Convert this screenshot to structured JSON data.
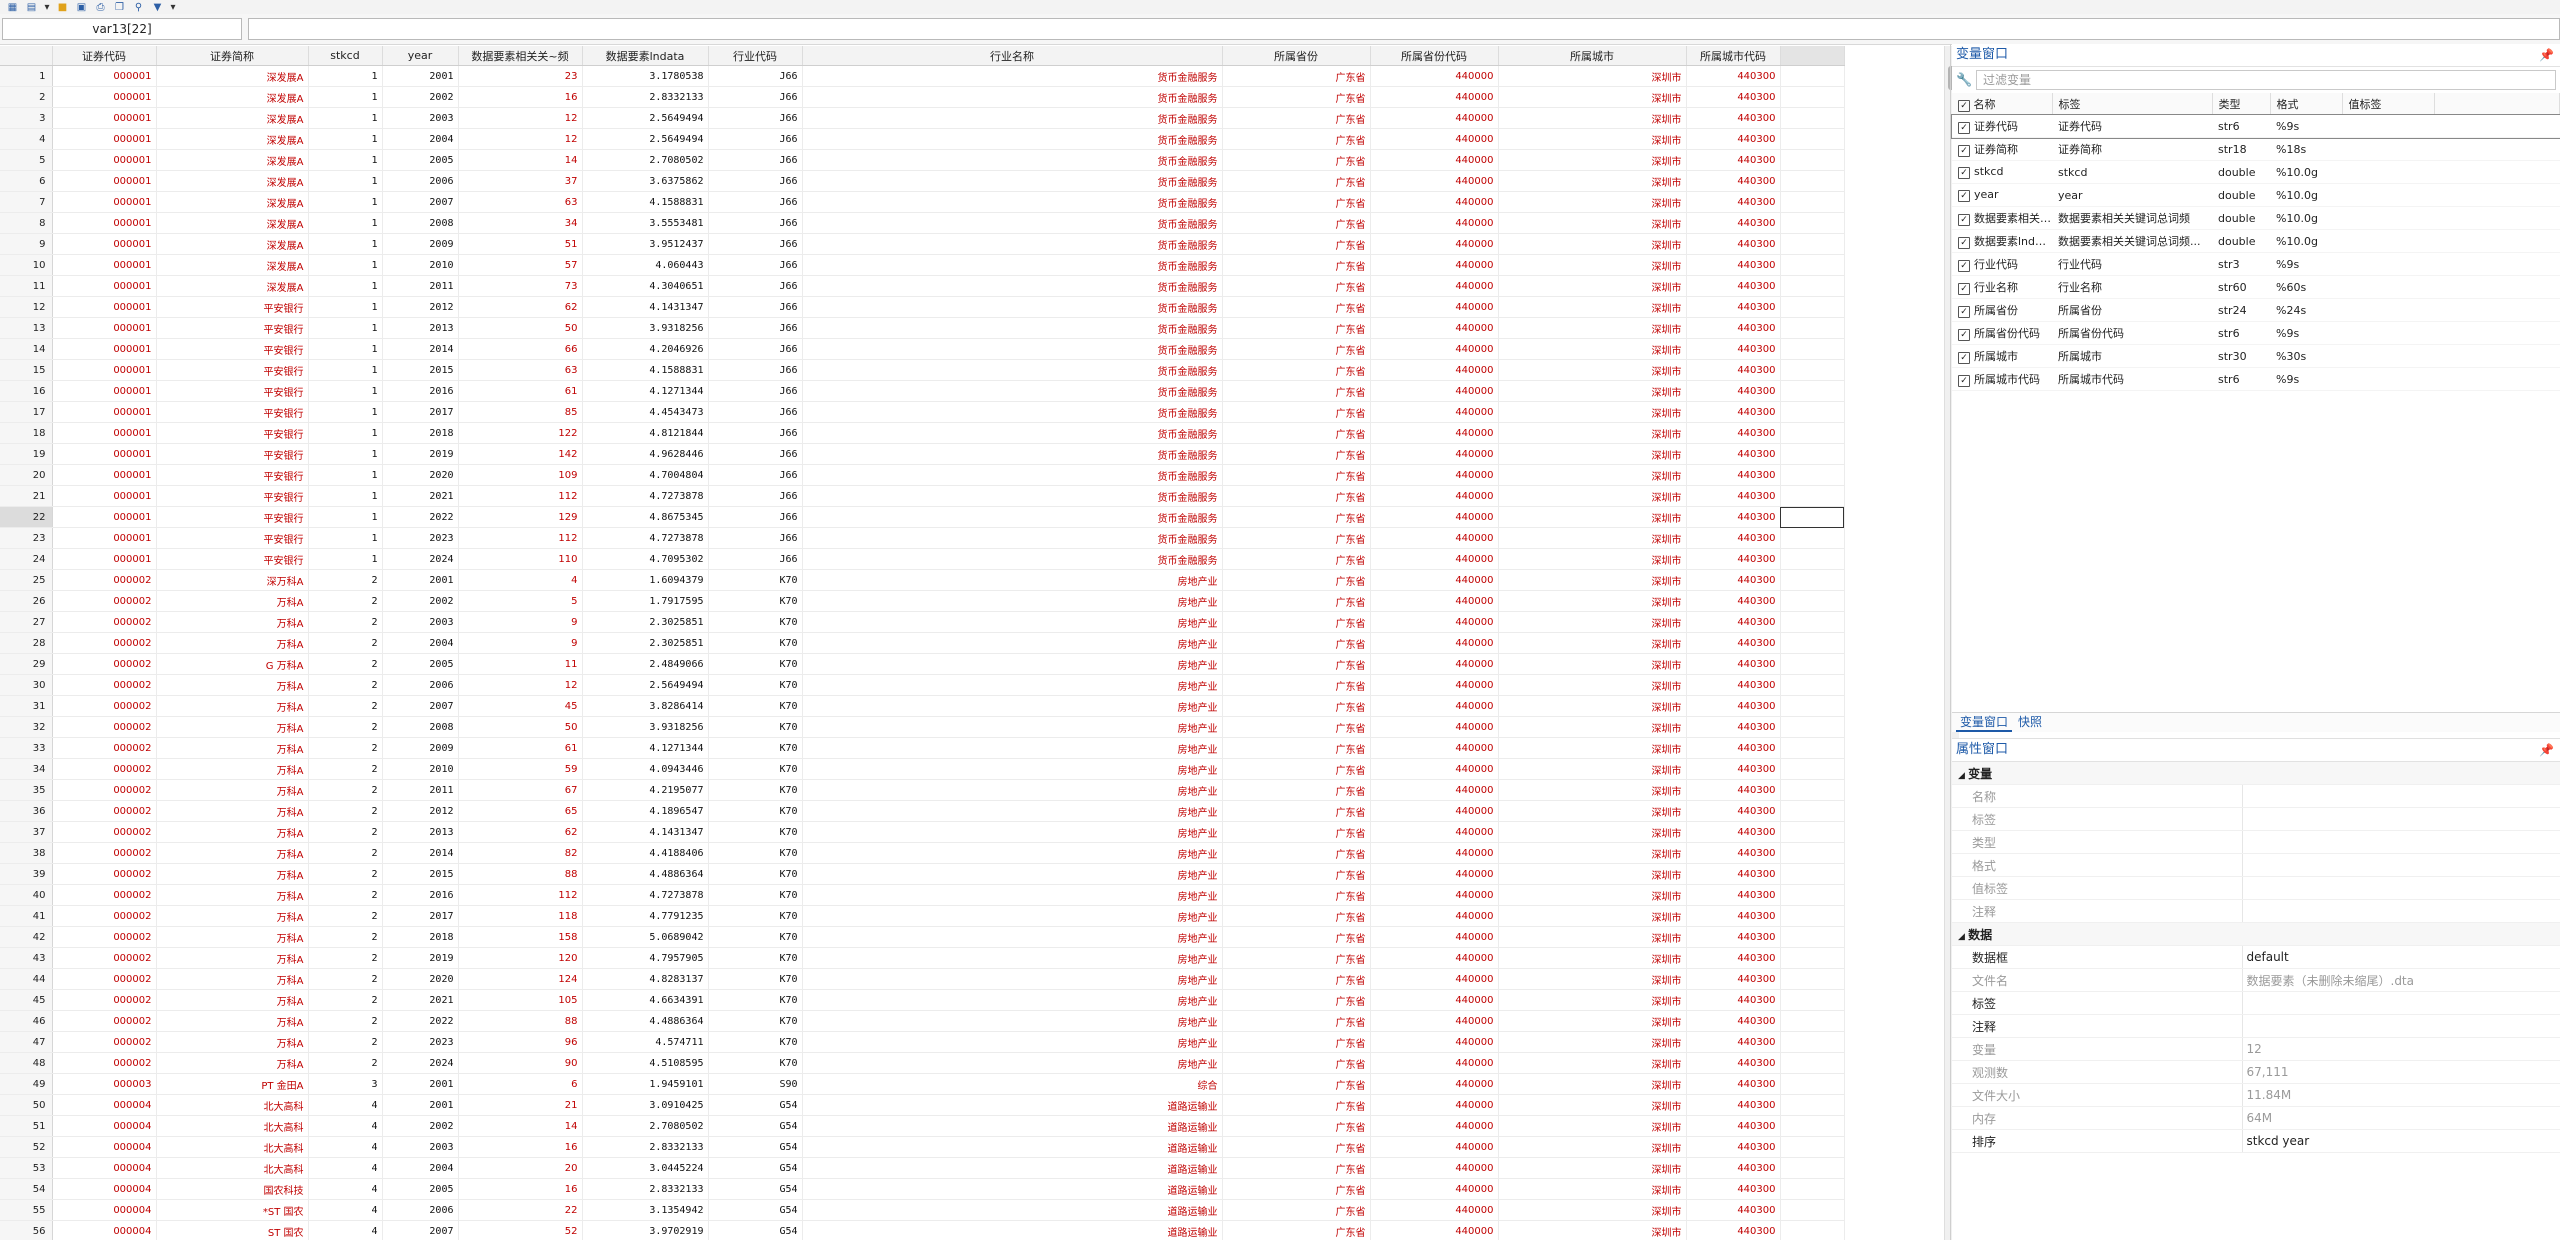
{
  "toolbar": {
    "icons": [
      "data-editor-icon",
      "browse-icon",
      "dropdown-arrow-icon",
      "open-folder-icon",
      "save-icon",
      "print-icon",
      "copy-icon",
      "search-icon",
      "filter-icon",
      "dropdown-arrow-icon"
    ]
  },
  "cellbar": {
    "name": "var13[22]",
    "value": ""
  },
  "grid": {
    "columns": [
      "证券代码",
      "证券简称",
      "stkcd",
      "year",
      "数据要素相关关~频",
      "数据要素lndata",
      "行业代码",
      "行业名称",
      "所属省份",
      "所属省份代码",
      "所属城市",
      "所属城市代码"
    ],
    "rows": [
      [
        "1",
        "000001",
        "深发展A",
        "1",
        "2001",
        "23",
        "3.1780538",
        "J66",
        "货币金融服务",
        "广东省",
        "440000",
        "深圳市",
        "440300"
      ],
      [
        "2",
        "000001",
        "深发展A",
        "1",
        "2002",
        "16",
        "2.8332133",
        "J66",
        "货币金融服务",
        "广东省",
        "440000",
        "深圳市",
        "440300"
      ],
      [
        "3",
        "000001",
        "深发展A",
        "1",
        "2003",
        "12",
        "2.5649494",
        "J66",
        "货币金融服务",
        "广东省",
        "440000",
        "深圳市",
        "440300"
      ],
      [
        "4",
        "000001",
        "深发展A",
        "1",
        "2004",
        "12",
        "2.5649494",
        "J66",
        "货币金融服务",
        "广东省",
        "440000",
        "深圳市",
        "440300"
      ],
      [
        "5",
        "000001",
        "深发展A",
        "1",
        "2005",
        "14",
        "2.7080502",
        "J66",
        "货币金融服务",
        "广东省",
        "440000",
        "深圳市",
        "440300"
      ],
      [
        "6",
        "000001",
        "深发展A",
        "1",
        "2006",
        "37",
        "3.6375862",
        "J66",
        "货币金融服务",
        "广东省",
        "440000",
        "深圳市",
        "440300"
      ],
      [
        "7",
        "000001",
        "深发展A",
        "1",
        "2007",
        "63",
        "4.1588831",
        "J66",
        "货币金融服务",
        "广东省",
        "440000",
        "深圳市",
        "440300"
      ],
      [
        "8",
        "000001",
        "深发展A",
        "1",
        "2008",
        "34",
        "3.5553481",
        "J66",
        "货币金融服务",
        "广东省",
        "440000",
        "深圳市",
        "440300"
      ],
      [
        "9",
        "000001",
        "深发展A",
        "1",
        "2009",
        "51",
        "3.9512437",
        "J66",
        "货币金融服务",
        "广东省",
        "440000",
        "深圳市",
        "440300"
      ],
      [
        "10",
        "000001",
        "深发展A",
        "1",
        "2010",
        "57",
        "4.060443",
        "J66",
        "货币金融服务",
        "广东省",
        "440000",
        "深圳市",
        "440300"
      ],
      [
        "11",
        "000001",
        "深发展A",
        "1",
        "2011",
        "73",
        "4.3040651",
        "J66",
        "货币金融服务",
        "广东省",
        "440000",
        "深圳市",
        "440300"
      ],
      [
        "12",
        "000001",
        "平安银行",
        "1",
        "2012",
        "62",
        "4.1431347",
        "J66",
        "货币金融服务",
        "广东省",
        "440000",
        "深圳市",
        "440300"
      ],
      [
        "13",
        "000001",
        "平安银行",
        "1",
        "2013",
        "50",
        "3.9318256",
        "J66",
        "货币金融服务",
        "广东省",
        "440000",
        "深圳市",
        "440300"
      ],
      [
        "14",
        "000001",
        "平安银行",
        "1",
        "2014",
        "66",
        "4.2046926",
        "J66",
        "货币金融服务",
        "广东省",
        "440000",
        "深圳市",
        "440300"
      ],
      [
        "15",
        "000001",
        "平安银行",
        "1",
        "2015",
        "63",
        "4.1588831",
        "J66",
        "货币金融服务",
        "广东省",
        "440000",
        "深圳市",
        "440300"
      ],
      [
        "16",
        "000001",
        "平安银行",
        "1",
        "2016",
        "61",
        "4.1271344",
        "J66",
        "货币金融服务",
        "广东省",
        "440000",
        "深圳市",
        "440300"
      ],
      [
        "17",
        "000001",
        "平安银行",
        "1",
        "2017",
        "85",
        "4.4543473",
        "J66",
        "货币金融服务",
        "广东省",
        "440000",
        "深圳市",
        "440300"
      ],
      [
        "18",
        "000001",
        "平安银行",
        "1",
        "2018",
        "122",
        "4.8121844",
        "J66",
        "货币金融服务",
        "广东省",
        "440000",
        "深圳市",
        "440300"
      ],
      [
        "19",
        "000001",
        "平安银行",
        "1",
        "2019",
        "142",
        "4.9628446",
        "J66",
        "货币金融服务",
        "广东省",
        "440000",
        "深圳市",
        "440300"
      ],
      [
        "20",
        "000001",
        "平安银行",
        "1",
        "2020",
        "109",
        "4.7004804",
        "J66",
        "货币金融服务",
        "广东省",
        "440000",
        "深圳市",
        "440300"
      ],
      [
        "21",
        "000001",
        "平安银行",
        "1",
        "2021",
        "112",
        "4.7273878",
        "J66",
        "货币金融服务",
        "广东省",
        "440000",
        "深圳市",
        "440300"
      ],
      [
        "22",
        "000001",
        "平安银行",
        "1",
        "2022",
        "129",
        "4.8675345",
        "J66",
        "货币金融服务",
        "广东省",
        "440000",
        "深圳市",
        "440300"
      ],
      [
        "23",
        "000001",
        "平安银行",
        "1",
        "2023",
        "112",
        "4.7273878",
        "J66",
        "货币金融服务",
        "广东省",
        "440000",
        "深圳市",
        "440300"
      ],
      [
        "24",
        "000001",
        "平安银行",
        "1",
        "2024",
        "110",
        "4.7095302",
        "J66",
        "货币金融服务",
        "广东省",
        "440000",
        "深圳市",
        "440300"
      ],
      [
        "25",
        "000002",
        "深万科A",
        "2",
        "2001",
        "4",
        "1.6094379",
        "K70",
        "房地产业",
        "广东省",
        "440000",
        "深圳市",
        "440300"
      ],
      [
        "26",
        "000002",
        "万科A",
        "2",
        "2002",
        "5",
        "1.7917595",
        "K70",
        "房地产业",
        "广东省",
        "440000",
        "深圳市",
        "440300"
      ],
      [
        "27",
        "000002",
        "万科A",
        "2",
        "2003",
        "9",
        "2.3025851",
        "K70",
        "房地产业",
        "广东省",
        "440000",
        "深圳市",
        "440300"
      ],
      [
        "28",
        "000002",
        "万科A",
        "2",
        "2004",
        "9",
        "2.3025851",
        "K70",
        "房地产业",
        "广东省",
        "440000",
        "深圳市",
        "440300"
      ],
      [
        "29",
        "000002",
        "G 万科A",
        "2",
        "2005",
        "11",
        "2.4849066",
        "K70",
        "房地产业",
        "广东省",
        "440000",
        "深圳市",
        "440300"
      ],
      [
        "30",
        "000002",
        "万科A",
        "2",
        "2006",
        "12",
        "2.5649494",
        "K70",
        "房地产业",
        "广东省",
        "440000",
        "深圳市",
        "440300"
      ],
      [
        "31",
        "000002",
        "万科A",
        "2",
        "2007",
        "45",
        "3.8286414",
        "K70",
        "房地产业",
        "广东省",
        "440000",
        "深圳市",
        "440300"
      ],
      [
        "32",
        "000002",
        "万科A",
        "2",
        "2008",
        "50",
        "3.9318256",
        "K70",
        "房地产业",
        "广东省",
        "440000",
        "深圳市",
        "440300"
      ],
      [
        "33",
        "000002",
        "万科A",
        "2",
        "2009",
        "61",
        "4.1271344",
        "K70",
        "房地产业",
        "广东省",
        "440000",
        "深圳市",
        "440300"
      ],
      [
        "34",
        "000002",
        "万科A",
        "2",
        "2010",
        "59",
        "4.0943446",
        "K70",
        "房地产业",
        "广东省",
        "440000",
        "深圳市",
        "440300"
      ],
      [
        "35",
        "000002",
        "万科A",
        "2",
        "2011",
        "67",
        "4.2195077",
        "K70",
        "房地产业",
        "广东省",
        "440000",
        "深圳市",
        "440300"
      ],
      [
        "36",
        "000002",
        "万科A",
        "2",
        "2012",
        "65",
        "4.1896547",
        "K70",
        "房地产业",
        "广东省",
        "440000",
        "深圳市",
        "440300"
      ],
      [
        "37",
        "000002",
        "万科A",
        "2",
        "2013",
        "62",
        "4.1431347",
        "K70",
        "房地产业",
        "广东省",
        "440000",
        "深圳市",
        "440300"
      ],
      [
        "38",
        "000002",
        "万科A",
        "2",
        "2014",
        "82",
        "4.4188406",
        "K70",
        "房地产业",
        "广东省",
        "440000",
        "深圳市",
        "440300"
      ],
      [
        "39",
        "000002",
        "万科A",
        "2",
        "2015",
        "88",
        "4.4886364",
        "K70",
        "房地产业",
        "广东省",
        "440000",
        "深圳市",
        "440300"
      ],
      [
        "40",
        "000002",
        "万科A",
        "2",
        "2016",
        "112",
        "4.7273878",
        "K70",
        "房地产业",
        "广东省",
        "440000",
        "深圳市",
        "440300"
      ],
      [
        "41",
        "000002",
        "万科A",
        "2",
        "2017",
        "118",
        "4.7791235",
        "K70",
        "房地产业",
        "广东省",
        "440000",
        "深圳市",
        "440300"
      ],
      [
        "42",
        "000002",
        "万科A",
        "2",
        "2018",
        "158",
        "5.0689042",
        "K70",
        "房地产业",
        "广东省",
        "440000",
        "深圳市",
        "440300"
      ],
      [
        "43",
        "000002",
        "万科A",
        "2",
        "2019",
        "120",
        "4.7957905",
        "K70",
        "房地产业",
        "广东省",
        "440000",
        "深圳市",
        "440300"
      ],
      [
        "44",
        "000002",
        "万科A",
        "2",
        "2020",
        "124",
        "4.8283137",
        "K70",
        "房地产业",
        "广东省",
        "440000",
        "深圳市",
        "440300"
      ],
      [
        "45",
        "000002",
        "万科A",
        "2",
        "2021",
        "105",
        "4.6634391",
        "K70",
        "房地产业",
        "广东省",
        "440000",
        "深圳市",
        "440300"
      ],
      [
        "46",
        "000002",
        "万科A",
        "2",
        "2022",
        "88",
        "4.4886364",
        "K70",
        "房地产业",
        "广东省",
        "440000",
        "深圳市",
        "440300"
      ],
      [
        "47",
        "000002",
        "万科A",
        "2",
        "2023",
        "96",
        "4.574711",
        "K70",
        "房地产业",
        "广东省",
        "440000",
        "深圳市",
        "440300"
      ],
      [
        "48",
        "000002",
        "万科A",
        "2",
        "2024",
        "90",
        "4.5108595",
        "K70",
        "房地产业",
        "广东省",
        "440000",
        "深圳市",
        "440300"
      ],
      [
        "49",
        "000003",
        "PT 金田A",
        "3",
        "2001",
        "6",
        "1.9459101",
        "S90",
        "综合",
        "广东省",
        "440000",
        "深圳市",
        "440300"
      ],
      [
        "50",
        "000004",
        "北大高科",
        "4",
        "2001",
        "21",
        "3.0910425",
        "G54",
        "道路运输业",
        "广东省",
        "440000",
        "深圳市",
        "440300"
      ],
      [
        "51",
        "000004",
        "北大高科",
        "4",
        "2002",
        "14",
        "2.7080502",
        "G54",
        "道路运输业",
        "广东省",
        "440000",
        "深圳市",
        "440300"
      ],
      [
        "52",
        "000004",
        "北大高科",
        "4",
        "2003",
        "16",
        "2.8332133",
        "G54",
        "道路运输业",
        "广东省",
        "440000",
        "深圳市",
        "440300"
      ],
      [
        "53",
        "000004",
        "北大高科",
        "4",
        "2004",
        "20",
        "3.0445224",
        "G54",
        "道路运输业",
        "广东省",
        "440000",
        "深圳市",
        "440300"
      ],
      [
        "54",
        "000004",
        "国农科技",
        "4",
        "2005",
        "16",
        "2.8332133",
        "G54",
        "道路运输业",
        "广东省",
        "440000",
        "深圳市",
        "440300"
      ],
      [
        "55",
        "000004",
        "*ST 国农",
        "4",
        "2006",
        "22",
        "3.1354942",
        "G54",
        "道路运输业",
        "广东省",
        "440000",
        "深圳市",
        "440300"
      ],
      [
        "56",
        "000004",
        "ST 国农",
        "4",
        "2007",
        "52",
        "3.9702919",
        "G54",
        "道路运输业",
        "广东省",
        "440000",
        "深圳市",
        "440300"
      ]
    ]
  },
  "variables_panel": {
    "title": "变量窗口",
    "filter_placeholder": "过滤变量",
    "headers": [
      "名称",
      "标签",
      "类型",
      "格式",
      "值标签"
    ],
    "vars": [
      {
        "name": "证券代码",
        "label": "证券代码",
        "type": "str6",
        "format": "%9s"
      },
      {
        "name": "证券简称",
        "label": "证券简称",
        "type": "str18",
        "format": "%18s"
      },
      {
        "name": "stkcd",
        "label": "stkcd",
        "type": "double",
        "format": "%10.0g"
      },
      {
        "name": "year",
        "label": "year",
        "type": "double",
        "format": "%10.0g"
      },
      {
        "name": "数据要素相关关...",
        "label": "数据要素相关关键词总词频",
        "type": "double",
        "format": "%10.0g"
      },
      {
        "name": "数据要素lndata",
        "label": "数据要素相关关键词总词频...",
        "type": "double",
        "format": "%10.0g"
      },
      {
        "name": "行业代码",
        "label": "行业代码",
        "type": "str3",
        "format": "%9s"
      },
      {
        "name": "行业名称",
        "label": "行业名称",
        "type": "str60",
        "format": "%60s"
      },
      {
        "name": "所属省份",
        "label": "所属省份",
        "type": "str24",
        "format": "%24s"
      },
      {
        "name": "所属省份代码",
        "label": "所属省份代码",
        "type": "str6",
        "format": "%9s"
      },
      {
        "name": "所属城市",
        "label": "所属城市",
        "type": "str30",
        "format": "%30s"
      },
      {
        "name": "所属城市代码",
        "label": "所属城市代码",
        "type": "str6",
        "format": "%9s"
      }
    ],
    "tabs": [
      "变量窗口",
      "快照"
    ]
  },
  "properties_panel": {
    "title": "属性窗口",
    "group_var": "变量",
    "var_props": [
      "名称",
      "标签",
      "类型",
      "格式",
      "值标签",
      "注释"
    ],
    "group_data": "数据",
    "data_props": [
      {
        "k": "数据框",
        "v": "default",
        "strong": true
      },
      {
        "k": "文件名",
        "v": "数据要素（未删除未缩尾）.dta",
        "strong": false
      },
      {
        "k": "标签",
        "v": "",
        "strong": true
      },
      {
        "k": "注释",
        "v": "",
        "strong": true
      },
      {
        "k": "变量",
        "v": "12",
        "strong": false
      },
      {
        "k": "观测数",
        "v": "67,111",
        "strong": false
      },
      {
        "k": "文件大小",
        "v": "11.84M",
        "strong": false
      },
      {
        "k": "内存",
        "v": "64M",
        "strong": false
      },
      {
        "k": "排序",
        "v": "stkcd year",
        "strong": true
      }
    ]
  },
  "pin_icon": "pin-icon"
}
